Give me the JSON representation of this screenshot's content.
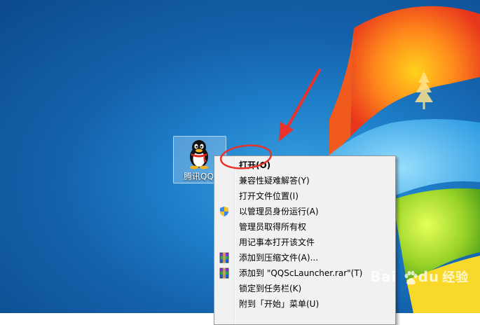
{
  "desktop": {
    "icon_label": "腾讯QQ",
    "watermark_brand": "Bai",
    "watermark_brand_end": "du",
    "watermark_suffix": "经验"
  },
  "context_menu": {
    "items": [
      {
        "label": "打开(O)",
        "icon": "",
        "bold": true
      },
      {
        "label": "兼容性疑难解答(Y)",
        "icon": ""
      },
      {
        "label": "打开文件位置(I)",
        "icon": ""
      },
      {
        "label": "以管理员身份运行(A)",
        "icon": "uac-shield-icon"
      },
      {
        "label": "管理员取得所有权",
        "icon": ""
      },
      {
        "label": "用记事本打开该文件",
        "icon": ""
      },
      {
        "label": "添加到压缩文件(A)...",
        "icon": "winrar-icon"
      },
      {
        "label": "添加到 \"QQScLauncher.rar\"(T)",
        "icon": "winrar-icon"
      },
      {
        "label": "锁定到任务栏(K)",
        "icon": ""
      },
      {
        "label": "附到「开始」菜单(U)",
        "icon": ""
      }
    ]
  },
  "colors": {
    "annotation_red": "#e8322b",
    "menu_bg": "#f1f1f1",
    "desktop_blue": "#1f7fc9"
  }
}
